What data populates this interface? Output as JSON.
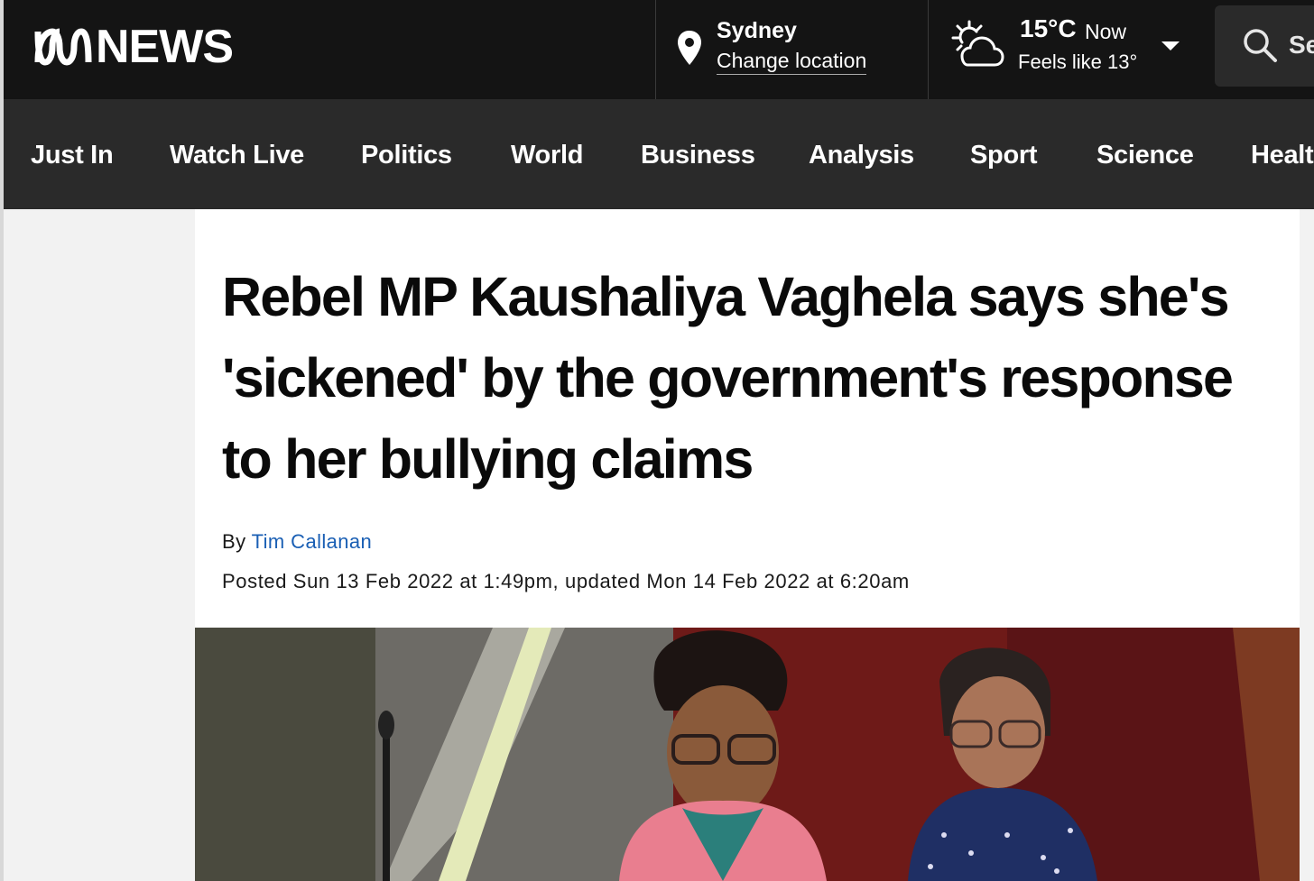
{
  "brand": {
    "logo_text": "NEWS"
  },
  "location": {
    "city": "Sydney",
    "change_label": "Change location"
  },
  "weather": {
    "temperature": "15°C",
    "period": "Now",
    "feels_like": "Feels like 13°",
    "icon": "partly-cloudy-sun-icon"
  },
  "search": {
    "label": "Se"
  },
  "nav": {
    "items": [
      {
        "label": "Just In"
      },
      {
        "label": "Watch Live"
      },
      {
        "label": "Politics"
      },
      {
        "label": "World"
      },
      {
        "label": "Business"
      },
      {
        "label": "Analysis"
      },
      {
        "label": "Sport"
      },
      {
        "label": "Science"
      },
      {
        "label": "Healt"
      }
    ]
  },
  "article": {
    "headline": "Rebel MP Kaushaliya Vaghela says she's 'sickened' by the government's response to her bullying claims",
    "by_label": "By",
    "author": "Tim Callanan",
    "posted": "Posted Sun 13 Feb 2022 at 1:49pm, updated Mon 14 Feb 2022 at 6:20am"
  },
  "colors": {
    "topbar": "#141414",
    "navbar": "#2a2a2a",
    "link": "#1a5fb4"
  }
}
